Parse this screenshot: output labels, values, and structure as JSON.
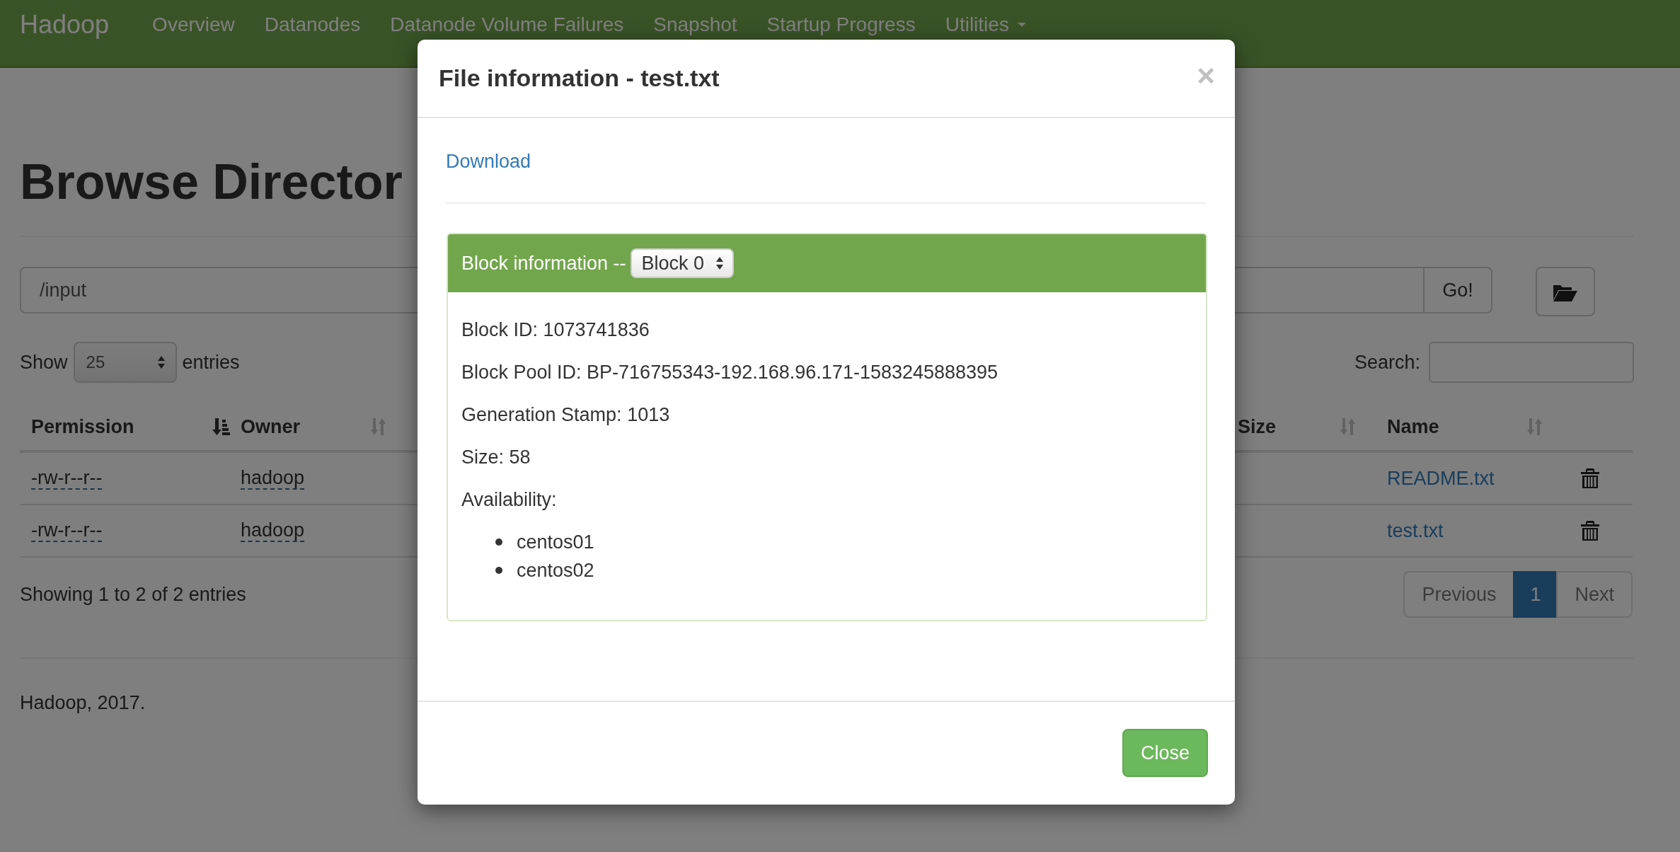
{
  "navbar": {
    "brand": "Hadoop",
    "items": [
      {
        "label": "Overview",
        "kind": "link"
      },
      {
        "label": "Datanodes",
        "kind": "link"
      },
      {
        "label": "Datanode Volume Failures",
        "kind": "link"
      },
      {
        "label": "Snapshot",
        "kind": "link"
      },
      {
        "label": "Startup Progress",
        "kind": "link"
      },
      {
        "label": "Utilities",
        "kind": "dropdown"
      }
    ]
  },
  "page": {
    "title": "Browse Director",
    "path_input": {
      "value": "/input"
    },
    "go_button": "Go!",
    "length": {
      "show_label": "Show",
      "value": "25",
      "entries_label": "entries"
    },
    "search": {
      "label": "Search:"
    },
    "table": {
      "columns": [
        {
          "label": "Permission",
          "sorted": true
        },
        {
          "label": "Owner",
          "sorted": false
        },
        {
          "label": "Size",
          "sorted": false
        },
        {
          "label": "Name",
          "sorted": false
        }
      ],
      "rows": [
        {
          "permission": "-rw-r--r--",
          "owner": "hadoop",
          "name": "README.txt"
        },
        {
          "permission": "-rw-r--r--",
          "owner": "hadoop",
          "name": "test.txt"
        }
      ]
    },
    "info": "Showing 1 to 2 of 2 entries",
    "pagination": [
      {
        "label": "Previous",
        "kind": "nav",
        "selected": false,
        "disabled": true
      },
      {
        "label": "1",
        "kind": "page",
        "selected": true,
        "disabled": false
      },
      {
        "label": "Next",
        "kind": "nav",
        "selected": false,
        "disabled": true
      }
    ]
  },
  "footer": "Hadoop, 2017.",
  "modal": {
    "title": "File information - test.txt",
    "close_glyph": "×",
    "download": "Download",
    "block_label": "Block information --",
    "block_select": "Block 0",
    "details": [
      "Block ID: 1073741836",
      "Block Pool ID: BP-716755343-192.168.96.171-1583245888395",
      "Generation Stamp: 1013",
      "Size: 58",
      "Availability:"
    ],
    "locations": [
      "centos01",
      "centos02"
    ],
    "close_button": "Close"
  }
}
